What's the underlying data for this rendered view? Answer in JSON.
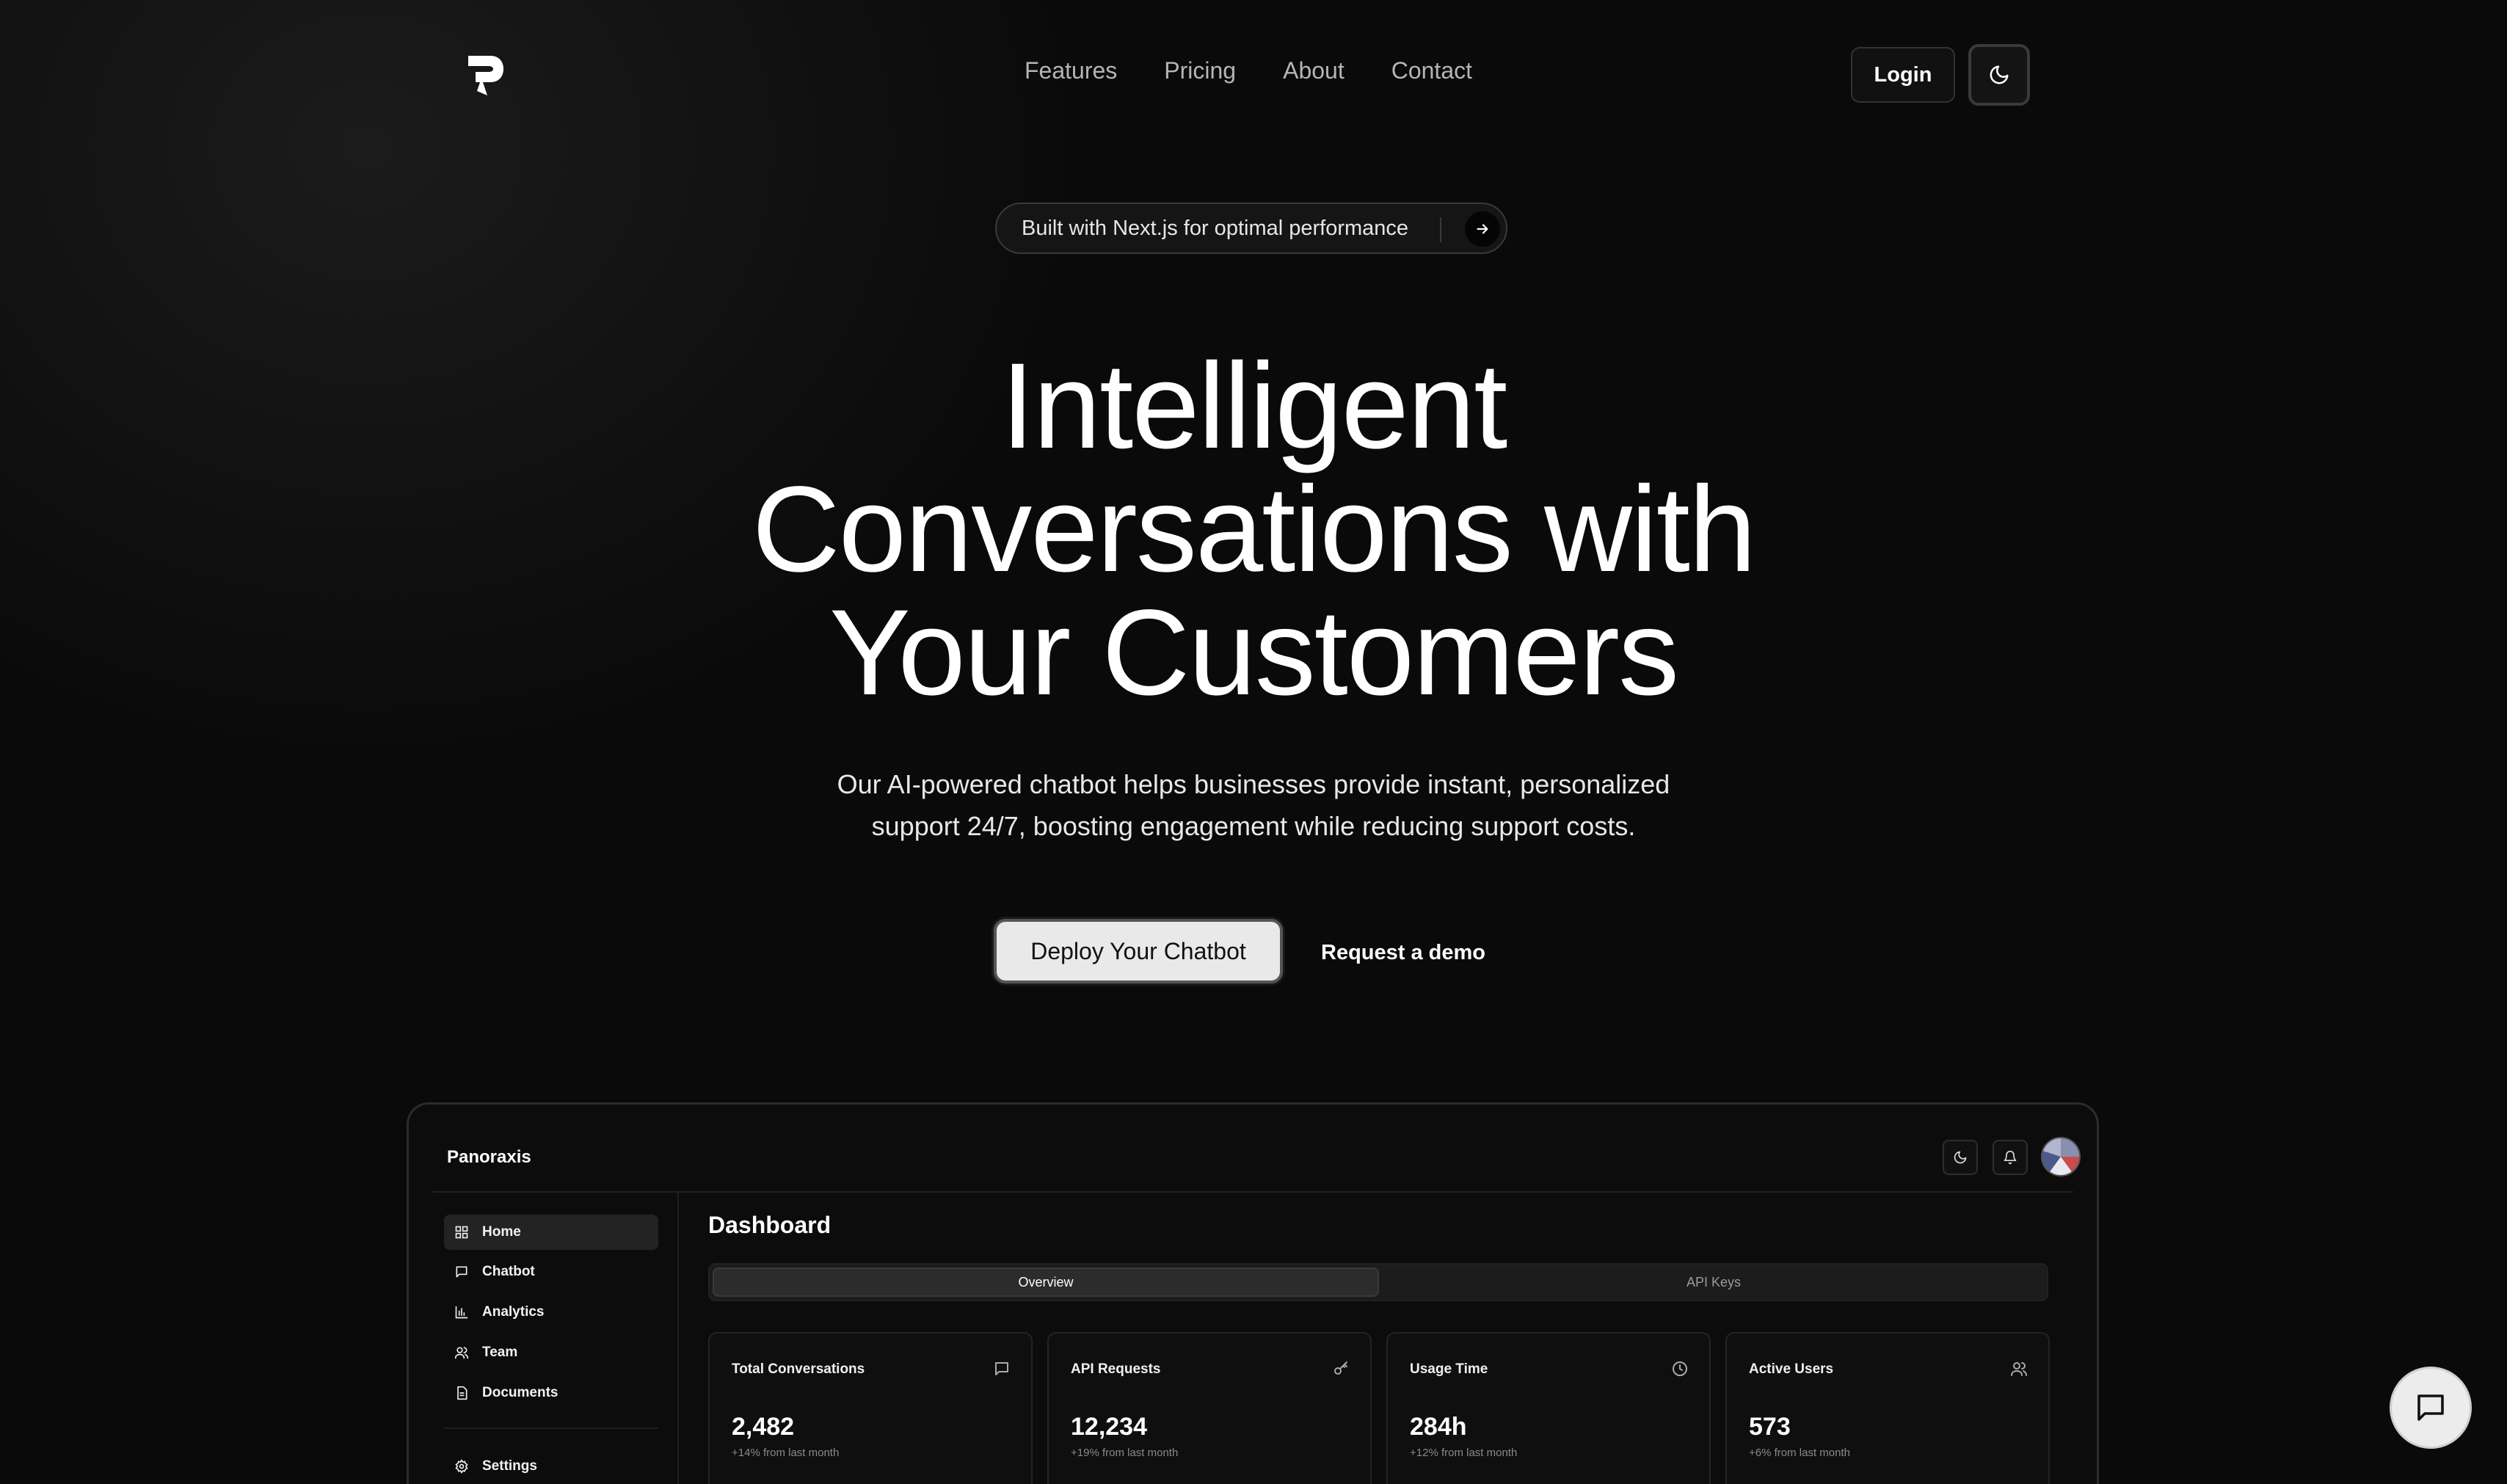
{
  "nav": {
    "logo_icon": "p-logo-icon",
    "links": [
      "Features",
      "Pricing",
      "About",
      "Contact"
    ],
    "login_label": "Login",
    "theme_icon": "moon-icon"
  },
  "announcement": {
    "text": "Built with Next.js for optimal performance",
    "icon": "arrow-right-icon"
  },
  "hero": {
    "title_line1": "Intelligent",
    "title_line2": "Conversations with",
    "title_line3": "Your Customers",
    "subtitle_line1": "Our AI-powered chatbot helps businesses provide instant, personalized",
    "subtitle_line2": "support 24/7, boosting engagement while reducing support costs.",
    "primary_cta": "Deploy Your Chatbot",
    "secondary_cta": "Request a demo"
  },
  "dashboard": {
    "brand": "Panoraxis",
    "header_icons": [
      "moon-icon",
      "bell-icon",
      "avatar"
    ],
    "sidebar": [
      {
        "label": "Home",
        "icon": "grid-icon",
        "active": true
      },
      {
        "label": "Chatbot",
        "icon": "message-icon",
        "active": false
      },
      {
        "label": "Analytics",
        "icon": "bar-chart-icon",
        "active": false
      },
      {
        "label": "Team",
        "icon": "users-icon",
        "active": false
      },
      {
        "label": "Documents",
        "icon": "file-icon",
        "active": false
      },
      {
        "label": "Settings",
        "icon": "gear-icon",
        "active": false
      }
    ],
    "title": "Dashboard",
    "tabs": [
      "Overview",
      "API Keys"
    ],
    "active_tab": "Overview",
    "cards": [
      {
        "label": "Total Conversations",
        "value": "2,482",
        "delta": "+14% from last month",
        "icon": "message-icon"
      },
      {
        "label": "API Requests",
        "value": "12,234",
        "delta": "+19% from last month",
        "icon": "key-icon"
      },
      {
        "label": "Usage Time",
        "value": "284h",
        "delta": "+12% from last month",
        "icon": "clock-icon"
      },
      {
        "label": "Active Users",
        "value": "573",
        "delta": "+6% from last month",
        "icon": "users-icon"
      }
    ]
  },
  "chat_widget": {
    "icon": "chat-icon"
  },
  "colors": {
    "background": "#0a0a0a",
    "text": "#ffffff",
    "muted": "#b5b5b5",
    "primary_button": "#e9e9e9"
  }
}
